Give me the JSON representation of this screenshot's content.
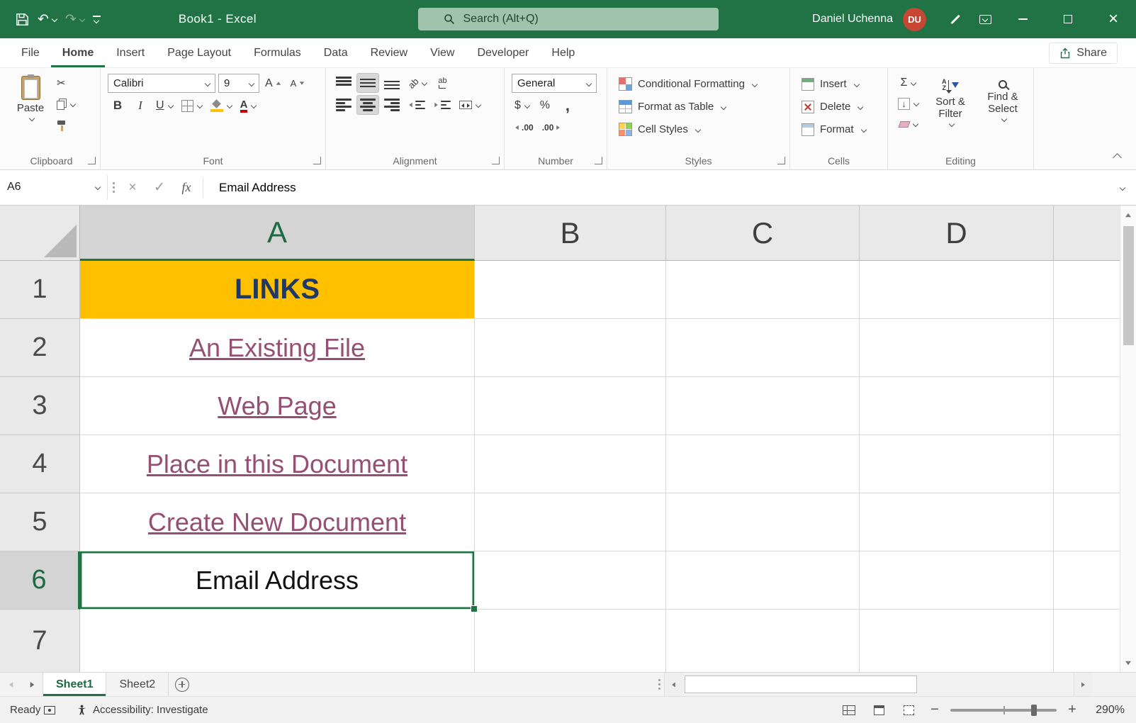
{
  "titlebar": {
    "title": "Book1  -  Excel",
    "search": "Search (Alt+Q)",
    "user": "Daniel Uchenna",
    "initials": "DU"
  },
  "glyphs": {
    "undo": "↶",
    "redo": "↷",
    "cut": "✂",
    "cancel": "×",
    "enter": "✓",
    "sigma": "Σ",
    "fill_arrow": "↓",
    "close": "×"
  },
  "ribbon": {
    "tabs": [
      {
        "label": "File"
      },
      {
        "label": "Home"
      },
      {
        "label": "Insert"
      },
      {
        "label": "Page Layout"
      },
      {
        "label": "Formulas"
      },
      {
        "label": "Data"
      },
      {
        "label": "Review"
      },
      {
        "label": "View"
      },
      {
        "label": "Developer"
      },
      {
        "label": "Help"
      }
    ],
    "share": "Share",
    "groups": {
      "clipboard": {
        "label": "Clipboard",
        "paste": "Paste"
      },
      "font": {
        "label": "Font",
        "name": "Calibri",
        "size": "9",
        "bold": "B",
        "italic": "I",
        "underline": "U",
        "a": "A"
      },
      "alignment": {
        "label": "Alignment",
        "ab": "ab"
      },
      "number": {
        "label": "Number",
        "format": "General",
        "currency": "$",
        "percent": "%",
        "comma": ",",
        "decimal": ".00"
      },
      "styles": {
        "label": "Styles",
        "conditional": "Conditional Formatting",
        "format_table": "Format as Table",
        "cell_styles": "Cell Styles"
      },
      "cells": {
        "label": "Cells",
        "insert": "Insert",
        "delete": "Delete",
        "format": "Format"
      },
      "editing": {
        "label": "Editing",
        "sort_filter": "Sort & Filter",
        "find_select": "Find & Select",
        "sort_a": "A",
        "sort_z": "Z"
      }
    }
  },
  "formula_bar": {
    "cell_ref": "A6",
    "fx": "fx",
    "content": "Email Address"
  },
  "grid": {
    "columns": [
      "A",
      "B",
      "C",
      "D"
    ],
    "rows": [
      {
        "num": "1",
        "a": "LINKS"
      },
      {
        "num": "2",
        "a": "An Existing File"
      },
      {
        "num": "3",
        "a": "Web Page"
      },
      {
        "num": "4",
        "a": "Place in this Document"
      },
      {
        "num": "5",
        "a": "Create New Document"
      },
      {
        "num": "6",
        "a": "Email Address"
      },
      {
        "num": "7",
        "a": ""
      }
    ],
    "colors": {
      "header_fill": "#FFC000",
      "header_text": "#1F3864",
      "hyperlink": "#954F72",
      "selection": "#217346"
    }
  },
  "sheets": {
    "tabs": [
      {
        "label": "Sheet1"
      },
      {
        "label": "Sheet2"
      }
    ]
  },
  "status": {
    "ready": "Ready",
    "accessibility": "Accessibility: Investigate",
    "zoom": "290%",
    "zoom_out": "−",
    "zoom_in": "+"
  }
}
